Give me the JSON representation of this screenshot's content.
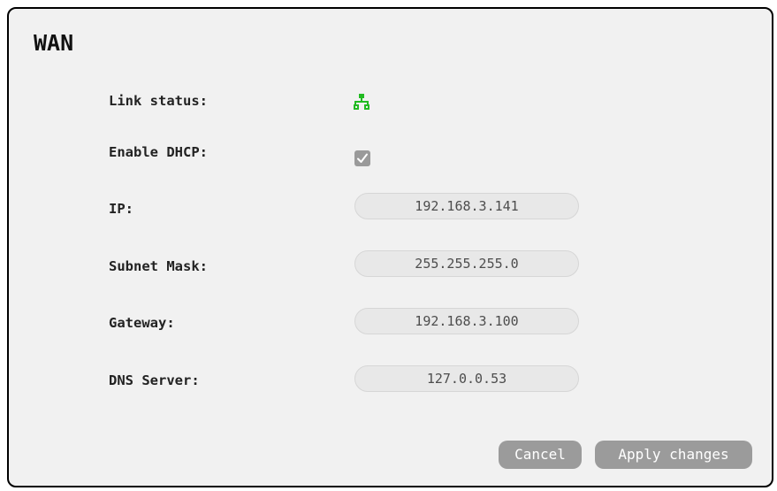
{
  "panel": {
    "title": "WAN"
  },
  "fields": {
    "link_status": {
      "label": "Link status:",
      "icon": "network-icon",
      "status": "connected",
      "color": "#22bb22"
    },
    "dhcp": {
      "label": "Enable DHCP:",
      "checked": true
    },
    "ip": {
      "label": "IP:",
      "value": "192.168.3.141"
    },
    "subnet": {
      "label": "Subnet Mask:",
      "value": "255.255.255.0"
    },
    "gateway": {
      "label": "Gateway:",
      "value": "192.168.3.100"
    },
    "dns": {
      "label": "DNS Server:",
      "value": "127.0.0.53"
    }
  },
  "buttons": {
    "cancel": "Cancel",
    "apply": "Apply changes"
  }
}
